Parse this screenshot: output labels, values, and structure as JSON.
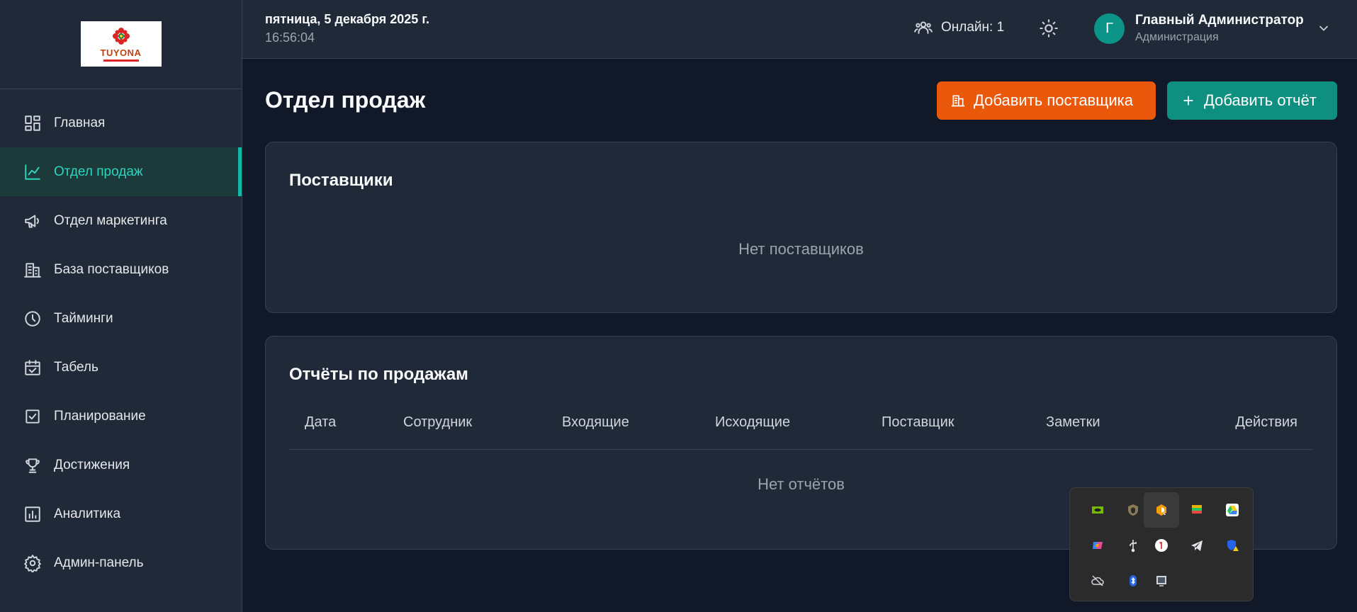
{
  "logo": {
    "brand": "TUYONA"
  },
  "sidebar": {
    "items": [
      {
        "label": "Главная",
        "icon": "dashboard-icon"
      },
      {
        "label": "Отдел продаж",
        "icon": "trend-chart-icon",
        "active": true
      },
      {
        "label": "Отдел маркетинга",
        "icon": "megaphone-icon"
      },
      {
        "label": "База поставщиков",
        "icon": "building-icon"
      },
      {
        "label": "Тайминги",
        "icon": "clock-icon"
      },
      {
        "label": "Табель",
        "icon": "calendar-check-icon"
      },
      {
        "label": "Планирование",
        "icon": "checkbox-icon"
      },
      {
        "label": "Достижения",
        "icon": "trophy-icon"
      },
      {
        "label": "Аналитика",
        "icon": "bar-chart-icon"
      },
      {
        "label": "Админ-панель",
        "icon": "gear-icon"
      }
    ]
  },
  "header": {
    "date": "пятница, 5 декабря 2025 г.",
    "time": "16:56:04",
    "online_label": "Онлайн: 1",
    "user": {
      "initial": "Г",
      "name": "Главный Администратор",
      "role": "Администрация"
    }
  },
  "main": {
    "title": "Отдел продаж",
    "add_supplier_label": "Добавить поставщика",
    "add_report_label": "Добавить отчёт",
    "suppliers": {
      "title": "Поставщики",
      "empty": "Нет поставщиков"
    },
    "reports": {
      "title": "Отчёты по продажам",
      "columns": [
        "Дата",
        "Сотрудник",
        "Входящие",
        "Исходящие",
        "Поставщик",
        "Заметки",
        "Действия"
      ],
      "empty": "Нет отчётов"
    }
  },
  "colors": {
    "accent": "#14b8a6",
    "orange": "#ea580c",
    "teal_button": "#0f8f80",
    "background": "#111827",
    "panel": "#1f2937"
  },
  "tray": {
    "icons": [
      "nvidia-icon",
      "shield-app-icon",
      "office-app-icon",
      "bluestacks-icon",
      "google-drive-icon",
      "copilot-icon",
      "usb-icon",
      "yandex-icon",
      "telegram-icon",
      "defender-warning-icon",
      "cloud-off-icon",
      "bluetooth-icon",
      "display-icon"
    ]
  }
}
